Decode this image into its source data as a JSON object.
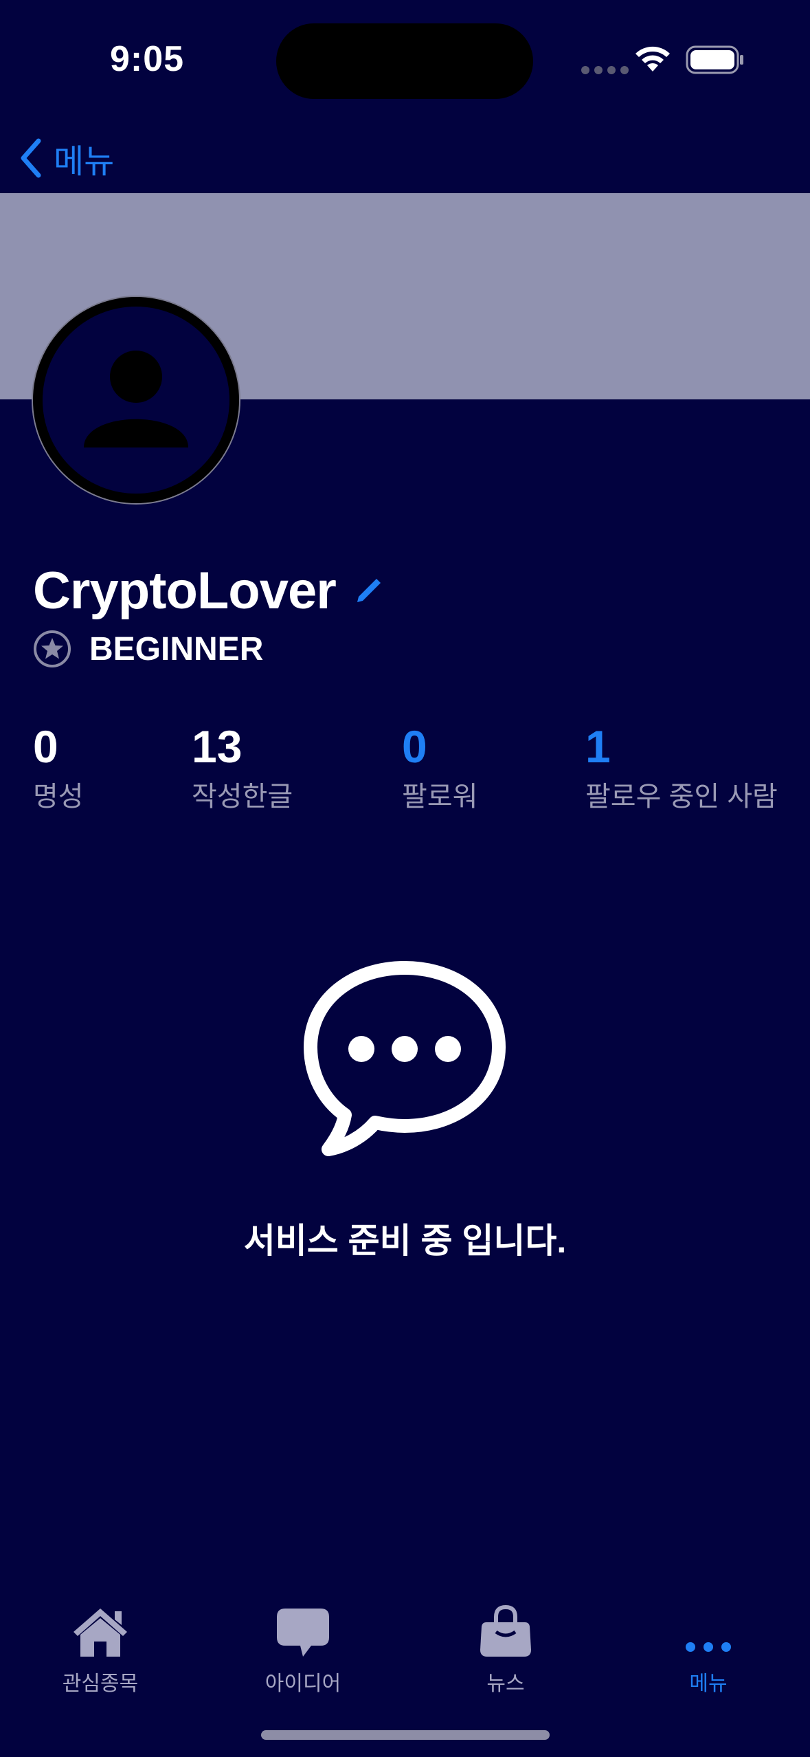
{
  "status_bar": {
    "time": "9:05"
  },
  "nav": {
    "back_label": "메뉴"
  },
  "profile": {
    "username": "CryptoLover",
    "rank": "BEGINNER"
  },
  "stats": [
    {
      "value": "0",
      "label": "명성"
    },
    {
      "value": "13",
      "label": "작성한글"
    },
    {
      "value": "0",
      "label": "팔로워"
    },
    {
      "value": "1",
      "label": "팔로우 중인 사람"
    }
  ],
  "empty_state": {
    "icon": "speech-bubble-ellipsis-icon",
    "message": "서비스 준비 중 입니다."
  },
  "tab_bar": {
    "tabs": [
      {
        "label": "관심종목",
        "icon": "home-icon",
        "active": false
      },
      {
        "label": "아이디어",
        "icon": "chat-bubble-icon",
        "active": false
      },
      {
        "label": "뉴스",
        "icon": "bag-icon",
        "active": false
      },
      {
        "label": "메뉴",
        "icon": "more-dots-icon",
        "active": true
      }
    ]
  },
  "colors": {
    "background": "#02023f",
    "banner": "#9092b0",
    "accent": "#1f7ff5",
    "muted_text": "#9a9ab5"
  }
}
